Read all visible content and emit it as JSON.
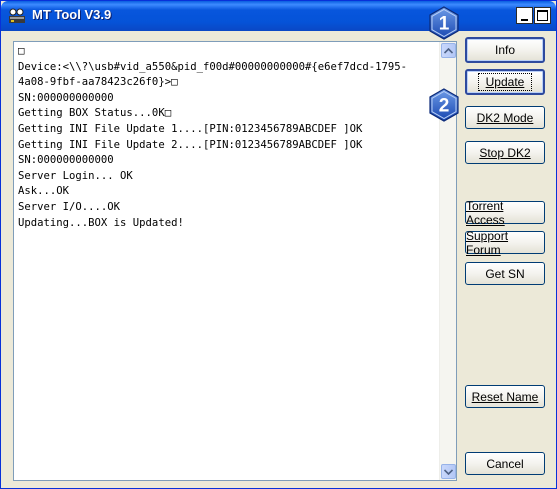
{
  "window": {
    "title": "MT Tool V3.9",
    "controls": {
      "minimize": "minimize-icon",
      "maximize": "maximize-icon"
    }
  },
  "log": {
    "lines": [
      "□",
      "Device:<\\\\?\\usb#vid_a550&pid_f00d#00000000000#{e6ef7dcd-1795-",
      "4a08-9fbf-aa78423c26f0}>□",
      "SN:000000000000",
      "Getting BOX Status...0K□",
      "Getting INI File Update 1....[PIN:0123456789ABCDEF ]OK",
      "Getting INI File Update 2....[PIN:0123456789ABCDEF ]OK",
      "SN:000000000000",
      "Server Login... OK",
      "Ask...OK",
      "Server I/O....OK",
      "Updating...BOX is Updated!"
    ]
  },
  "buttons": {
    "info": "Info",
    "update": "Update",
    "dk2_mode": "DK2 Mode",
    "stop_dk2": "Stop DK2",
    "torrent_access": "Torrent Access",
    "support_forum": "Support Forum",
    "get_sn": "Get SN",
    "reset_name": "Reset Name",
    "cancel": "Cancel"
  },
  "callouts": {
    "step1": "1",
    "step2": "2"
  },
  "colors": {
    "titlebar": "#0553d8",
    "window_bg": "#ece9d8",
    "callout_blue": "#1c5bc8",
    "focus_border": "#2e4a9e"
  }
}
